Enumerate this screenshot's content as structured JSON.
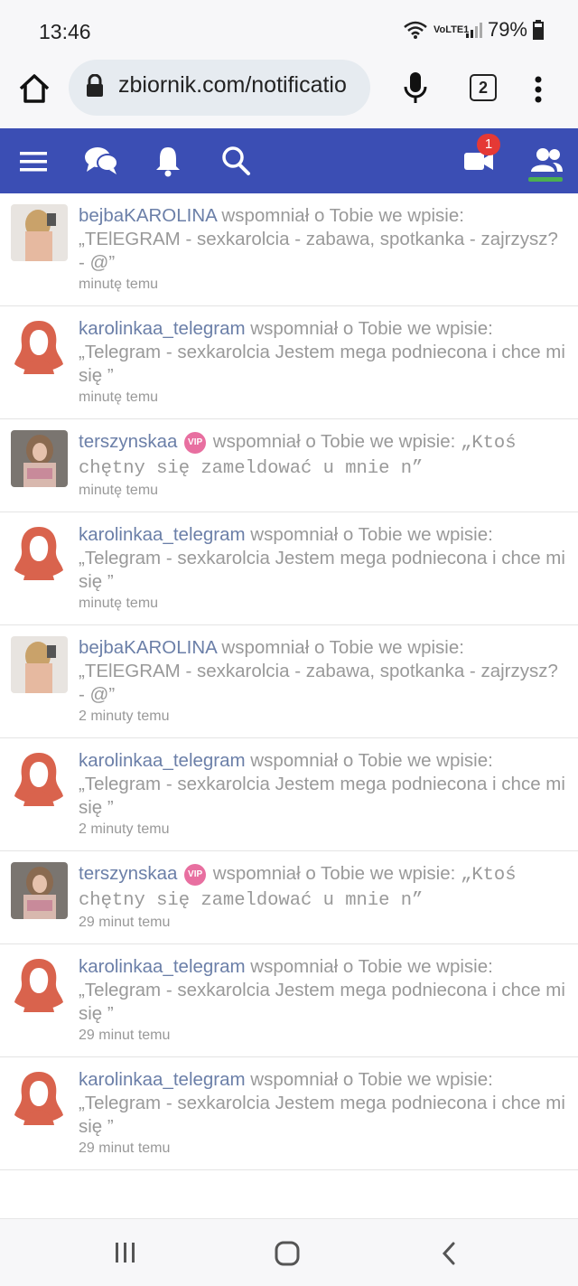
{
  "status": {
    "time": "13:46",
    "network": "VoLTE1",
    "battery": "79%"
  },
  "browser": {
    "url": "zbiornik.com/notificatio",
    "tab_count": "2"
  },
  "nav": {
    "badge": "1"
  },
  "notifications": [
    {
      "user": "bejbaKAROLINA",
      "vip": false,
      "action": " wspomniał o Tobie we wpisie: ",
      "quote": "„TElEGRAM - sexkarolcia - zabawa, spotkanka - zajrzysz? - @”",
      "time": "minutę temu",
      "avatar": "photo-blonde"
    },
    {
      "user": "karolinkaa_telegram",
      "vip": false,
      "action": " wspomniał o Tobie we wpisie: ",
      "quote": "„Telegram - sexkarolcia Jestem mega podniecona i chce mi się ”",
      "time": "minutę temu",
      "avatar": "default-female"
    },
    {
      "user": "terszynskaa",
      "vip": true,
      "action": " wspomniał o Tobie we wpisie: ",
      "quote": "„Ktoś chętny się zameldować u mnie n”",
      "time": "minutę temu",
      "avatar": "photo-brunette"
    },
    {
      "user": "karolinkaa_telegram",
      "vip": false,
      "action": " wspomniał o Tobie we wpisie: ",
      "quote": "„Telegram - sexkarolcia Jestem mega podniecona i chce mi się ”",
      "time": "minutę temu",
      "avatar": "default-female"
    },
    {
      "user": "bejbaKAROLINA",
      "vip": false,
      "action": " wspomniał o Tobie we wpisie: ",
      "quote": "„TElEGRAM - sexkarolcia - zabawa, spotkanka - zajrzysz? - @”",
      "time": "2 minuty temu",
      "avatar": "photo-blonde"
    },
    {
      "user": "karolinkaa_telegram",
      "vip": false,
      "action": " wspomniał o Tobie we wpisie: ",
      "quote": "„Telegram - sexkarolcia Jestem mega podniecona i chce mi się ”",
      "time": "2 minuty temu",
      "avatar": "default-female"
    },
    {
      "user": "terszynskaa",
      "vip": true,
      "action": " wspomniał o Tobie we wpisie: ",
      "quote": "„Ktoś chętny się zameldować u mnie n”",
      "time": "29 minut temu",
      "avatar": "photo-brunette"
    },
    {
      "user": "karolinkaa_telegram",
      "vip": false,
      "action": " wspomniał o Tobie we wpisie: ",
      "quote": "„Telegram - sexkarolcia Jestem mega podniecona i chce mi się ”",
      "time": "29 minut temu",
      "avatar": "default-female"
    },
    {
      "user": "karolinkaa_telegram",
      "vip": false,
      "action": " wspomniał o Tobie we wpisie: ",
      "quote": "„Telegram - sexkarolcia Jestem mega podniecona i chce mi się ”",
      "time": "29 minut temu",
      "avatar": "default-female"
    }
  ],
  "vip_label": "VIP",
  "colors": {
    "nav_bg": "#3b4eb4",
    "username": "#6b7fa8",
    "avatar_default": "#d9634d",
    "vip": "#e86fa0",
    "badge": "#e53935",
    "active_underline": "#4caf50"
  }
}
